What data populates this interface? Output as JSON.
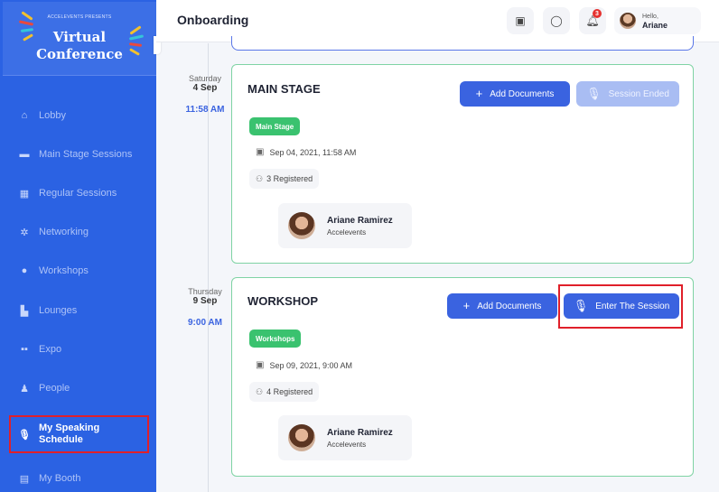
{
  "sidebar": {
    "logo": {
      "small": "ACCELEVENTS PRESENTS",
      "line1": "Virtual",
      "line2": "Conference"
    },
    "items": [
      {
        "label": "Lobby",
        "icon": "home-icon"
      },
      {
        "label": "Main Stage Sessions",
        "icon": "video-icon"
      },
      {
        "label": "Regular Sessions",
        "icon": "calendar-icon"
      },
      {
        "label": "Networking",
        "icon": "network-icon"
      },
      {
        "label": "Workshops",
        "icon": "group-icon"
      },
      {
        "label": "Lounges",
        "icon": "lounge-icon"
      },
      {
        "label": "Expo",
        "icon": "grid-icon"
      },
      {
        "label": "People",
        "icon": "person-icon"
      },
      {
        "label": "My Speaking Schedule",
        "icon": "microphone-icon",
        "active": true
      },
      {
        "label": "My Booth",
        "icon": "booth-icon"
      }
    ]
  },
  "header": {
    "title": "Onboarding",
    "notification_count": "3",
    "user": {
      "greeting": "Hello,",
      "name": "Ariane"
    }
  },
  "sessions": [
    {
      "day": "Saturday",
      "date": "4 Sep",
      "time": "11:58 AM",
      "title": "MAIN STAGE",
      "tag": "Main Stage",
      "datetime": "Sep 04, 2021, 11:58 AM",
      "registered": "3 Registered",
      "add_label": "Add Documents",
      "action_label": "Session Ended",
      "speaker": {
        "name": "Ariane Ramirez",
        "org": "Accelevents"
      }
    },
    {
      "day": "Thursday",
      "date": "9 Sep",
      "time": "9:00 AM",
      "title": "WORKSHOP",
      "tag": "Workshops",
      "datetime": "Sep 09, 2021, 9:00 AM",
      "registered": "4 Registered",
      "add_label": "Add Documents",
      "action_label": "Enter The Session",
      "speaker": {
        "name": "Ariane Ramirez",
        "org": "Accelevents"
      }
    }
  ],
  "colors": {
    "sidebar": "#2b62e3",
    "primary": "#3a63e0",
    "tag": "#3ac26f",
    "highlight": "#e0202a"
  }
}
